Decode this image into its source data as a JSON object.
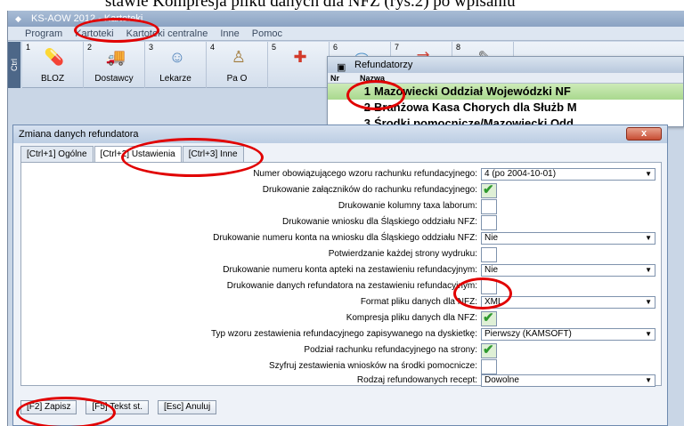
{
  "doc_text": "stawie Kompresja pliku danych dla NFZ (rys.2) po wpisaniu",
  "app": {
    "title": "KS-AOW 2012 - Kartoteki",
    "menu": [
      "Program",
      "Kartoteki",
      "Kartoteki centralne",
      "Inne",
      "Pomoc"
    ],
    "ctrl_label": "Ctrl"
  },
  "toolbar": [
    {
      "num": "1",
      "label": "BLOZ",
      "icon": "pills-icon"
    },
    {
      "num": "2",
      "label": "Dostawcy",
      "icon": "truck-icon"
    },
    {
      "num": "3",
      "label": "Lekarze",
      "icon": "doctor-icon"
    },
    {
      "num": "4",
      "label": "Pa O",
      "icon": "patient-icon"
    },
    {
      "num": "5",
      "label": "",
      "icon": "first-aid-icon"
    },
    {
      "num": "6",
      "label": "",
      "icon": "eraser-icon"
    },
    {
      "num": "7",
      "label": "",
      "icon": "exchange-icon"
    },
    {
      "num": "8",
      "label": "",
      "icon": "tool-icon"
    }
  ],
  "refundatorzy": {
    "title": "Refundatorzy",
    "col_nr": "Nr",
    "col_nazwa": "Nazwa",
    "rows": [
      {
        "nr": "1",
        "name": "Mazowiecki Oddział Wojewódzki NF"
      },
      {
        "nr": "2",
        "name": "Branżowa Kasa Chorych dla Służb M"
      },
      {
        "nr": "3",
        "name": "Środki pomocnicze/Mazowiecki Odd"
      }
    ]
  },
  "dialog": {
    "title": "Zmiana danych refundatora",
    "close_label": "x",
    "tabs": [
      "[Ctrl+1] Ogólne",
      "[Ctrl+2] Ustawienia",
      "[Ctrl+3] Inne"
    ],
    "fields": [
      {
        "label": "Numer obowiązującego wzoru rachunku refundacyjnego:",
        "type": "select",
        "value": "4 (po 2004-10-01)"
      },
      {
        "label": "Drukowanie załączników do rachunku refundacyjnego:",
        "type": "checkbox",
        "checked": true
      },
      {
        "label": "Drukowanie kolumny taxa laborum:",
        "type": "checkbox",
        "checked": false
      },
      {
        "label": "Drukowanie wniosku dla Śląskiego oddziału NFZ:",
        "type": "checkbox",
        "checked": false
      },
      {
        "label": "Drukowanie numeru konta na wniosku dla Śląskiego oddziału NFZ:",
        "type": "select",
        "value": "Nie"
      },
      {
        "label": "Potwierdzanie każdej strony wydruku:",
        "type": "checkbox",
        "checked": false
      },
      {
        "label": "Drukowanie numeru konta apteki na zestawieniu refundacyjnym:",
        "type": "select",
        "value": "Nie"
      },
      {
        "label": "Drukowanie danych refundatora na zestawieniu refundacyjnym:",
        "type": "checkbox",
        "checked": false
      },
      {
        "label": "Format pliku danych dla NFZ:",
        "type": "select",
        "value": "XML"
      },
      {
        "label": "Kompresja pliku danych dla NFZ:",
        "type": "checkbox",
        "checked": true
      },
      {
        "label": "Typ wzoru zestawienia refundacyjnego zapisywanego na dyskietkę:",
        "type": "select",
        "value": "Pierwszy (KAMSOFT)"
      },
      {
        "label": "Podział rachunku refundacyjnego na strony:",
        "type": "checkbox",
        "checked": true
      },
      {
        "label": "Szyfruj zestawienia wniosków na środki pomocnicze:",
        "type": "checkbox",
        "checked": false
      },
      {
        "label": "Rodzaj refundowanych recept:",
        "type": "select",
        "value": "Dowolne"
      }
    ],
    "buttons": {
      "save": "[F2] Zapisz",
      "text": "[F5] Tekst st.",
      "cancel": "[Esc] Anuluj"
    }
  },
  "colors": {
    "annotation": "#e10000",
    "check": "#2f9a2f"
  }
}
